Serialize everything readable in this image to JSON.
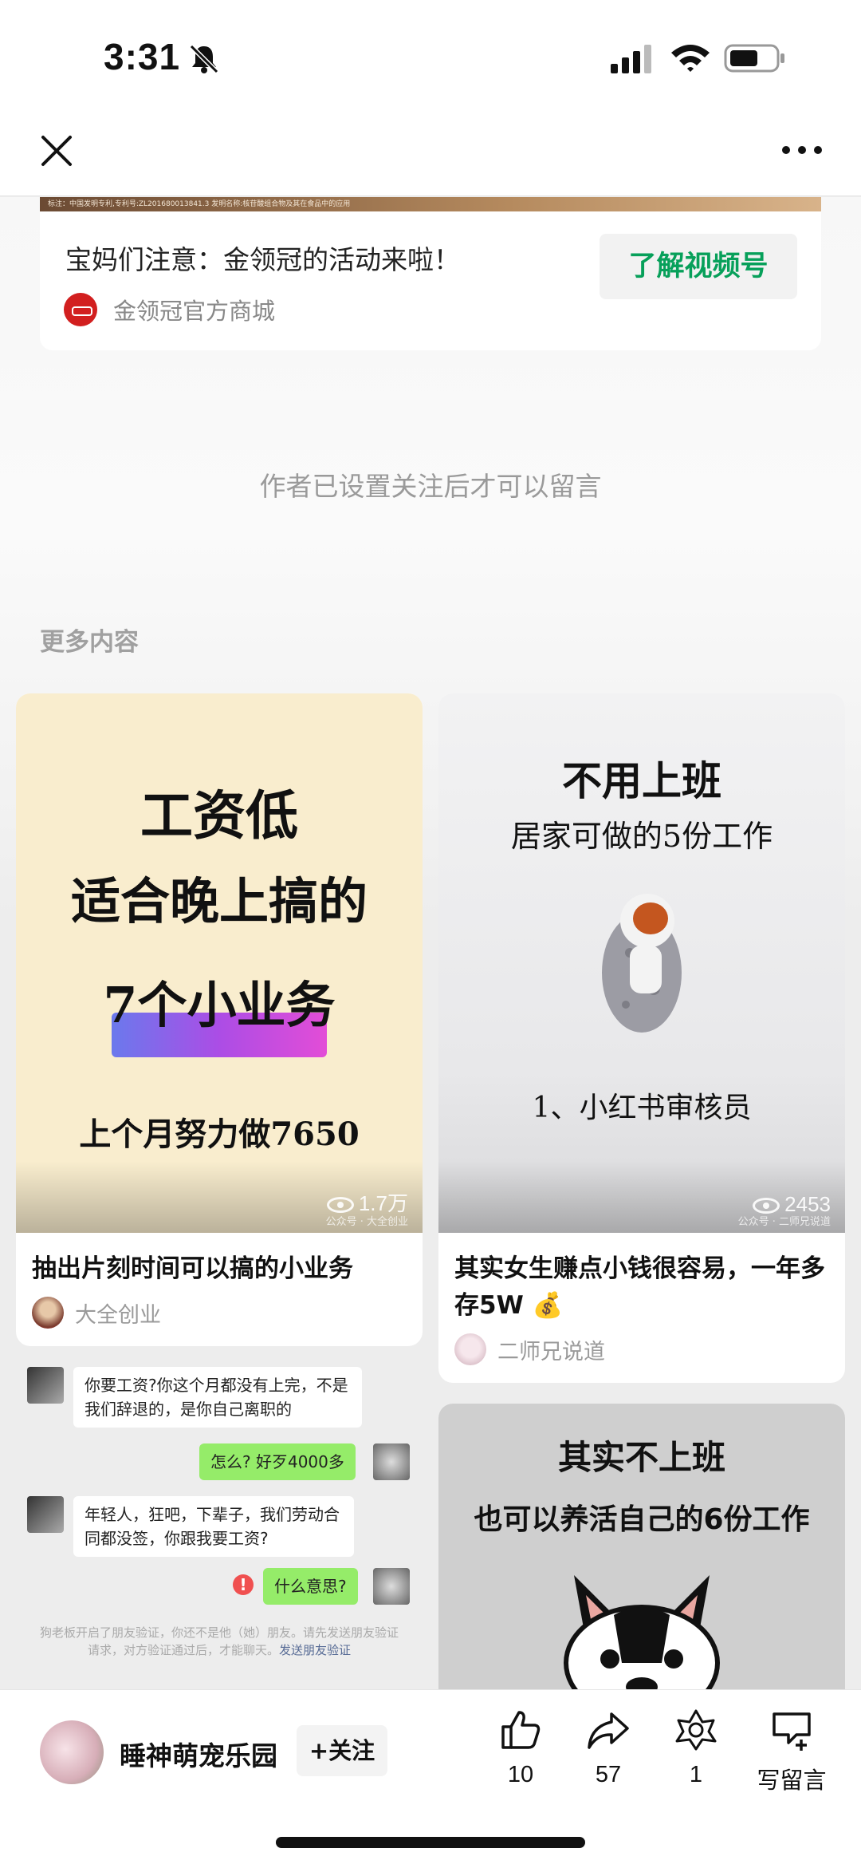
{
  "status_bar": {
    "time": "3:31"
  },
  "ad": {
    "strip_text": "标注：中国发明专利,专利号:ZL201680013841.3   发明名称:核苷酸组合物及其在食品中的应用",
    "title": "宝妈们注意：金领冠的活动来啦！",
    "source": "金领冠官方商城",
    "button": "了解视频号"
  },
  "comment_note": "作者已设置关注后才可以留言",
  "more_section": {
    "title": "更多内容"
  },
  "cards": [
    {
      "thumb_lines": [
        "工资低",
        "适合晚上搞的",
        "7个小业务",
        "上个月努力做7650"
      ],
      "views": "1.7万",
      "watermark": "公众号 · 大全创业",
      "title": "抽出片刻时间可以搞的小业务",
      "author": "大全创业"
    },
    {
      "thumb_lines": [
        "不用上班",
        "居家可做的5份工作",
        "1、小红书审核员"
      ],
      "views": "2453",
      "watermark": "公众号 · 二师兄说道",
      "title": "其实女生赚点小钱很容易，一年多存5W 💰",
      "author": "二师兄说道"
    },
    {
      "thumb_lines": [
        "其实不上班",
        "也可以养活自己的6份工作"
      ]
    }
  ],
  "chat_thumb": {
    "messages": [
      {
        "side": "left",
        "text": "你要工资?你这个月都没有上完，不是我们辞退的，是你自己离职的"
      },
      {
        "side": "right",
        "text": "怎么? 好歹4000多"
      },
      {
        "side": "left",
        "text": "年轻人，狂吧，下辈子，我们劳动合同都没签，你跟我要工资?"
      },
      {
        "side": "right",
        "text": "什么意思?",
        "warn": "!"
      }
    ],
    "system_text": "狗老板开启了朋友验证，你还不是他（她）朋友。请先发送朋友验证请求，对方验证通过后，才能聊天。",
    "system_link": "发送朋友验证"
  },
  "bottom_bar": {
    "account_name": "睡神萌宠乐园",
    "follow_label": "+关注",
    "like_count": "10",
    "share_count": "57",
    "recommend_count": "1",
    "comment_label": "写留言"
  }
}
